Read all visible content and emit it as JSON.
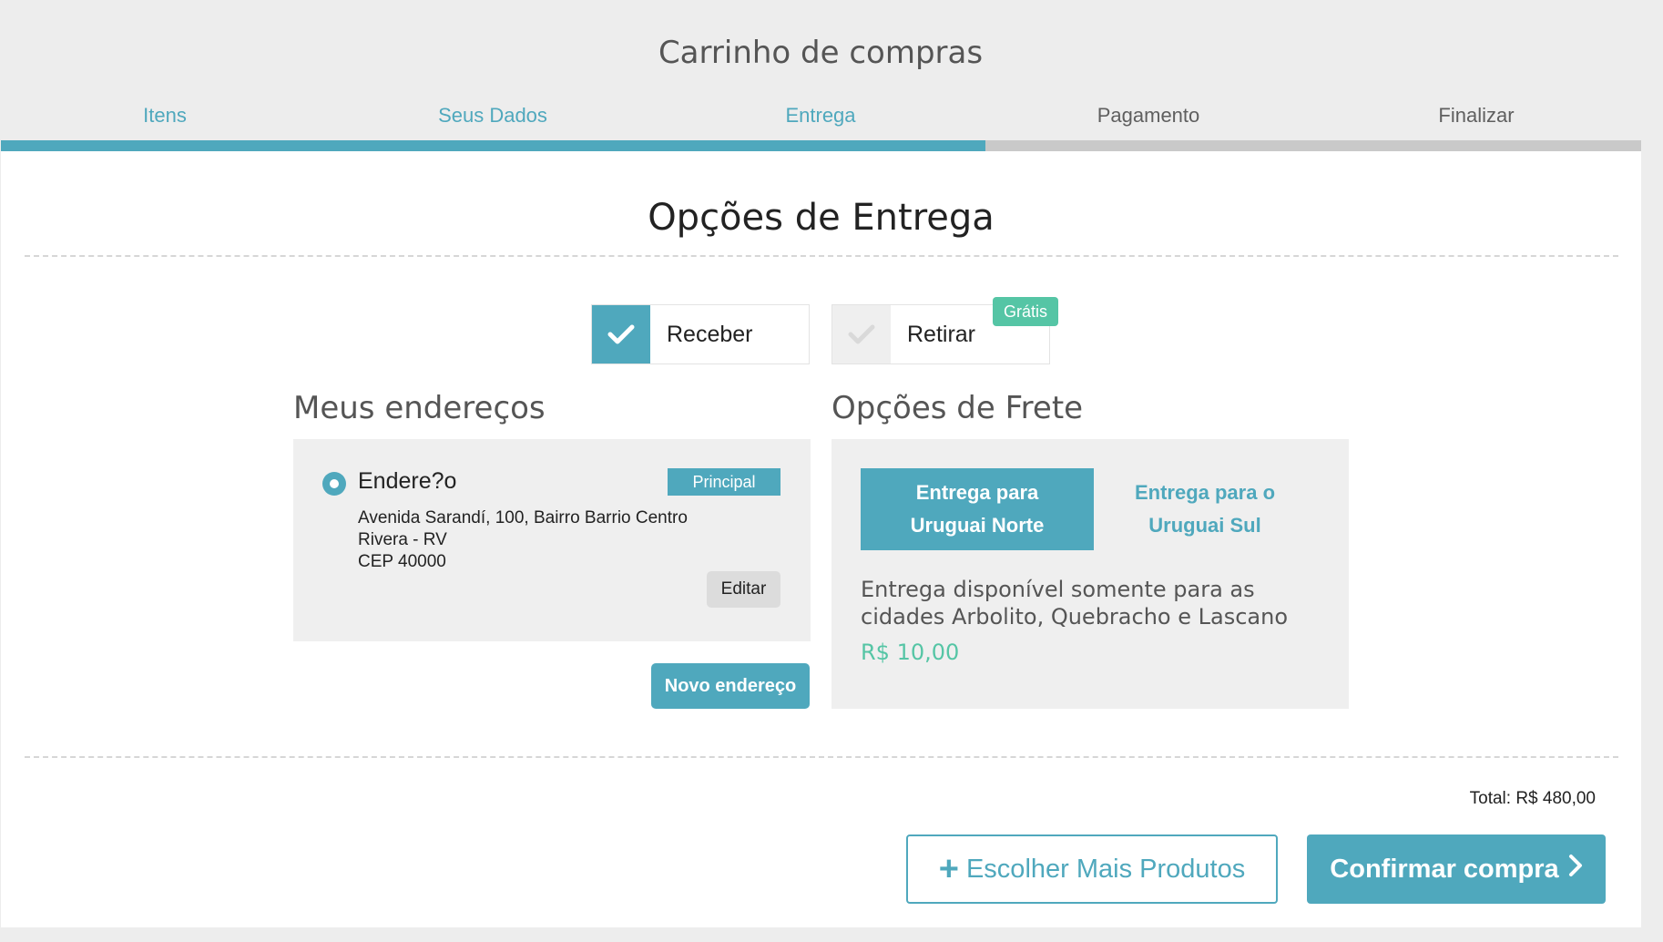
{
  "header": {
    "title": "Carrinho de compras"
  },
  "steps": [
    {
      "label": "Itens",
      "state": "done"
    },
    {
      "label": "Seus Dados",
      "state": "done"
    },
    {
      "label": "Entrega",
      "state": "done"
    },
    {
      "label": "Pagamento",
      "state": "todo"
    },
    {
      "label": "Finalizar",
      "state": "todo"
    }
  ],
  "progress": {
    "completed_fraction": 0.6
  },
  "delivery": {
    "title": "Opções de Entrega",
    "options": [
      {
        "label": "Receber",
        "selected": true
      },
      {
        "label": "Retirar",
        "selected": false,
        "badge": "Grátis"
      }
    ]
  },
  "addresses": {
    "title": "Meus endereços",
    "items": [
      {
        "name": "Endere?o",
        "badge": "Principal",
        "line1": "Avenida Sarandí, 100, Bairro Barrio Centro",
        "line2": "Rivera - RV",
        "line3": "CEP 40000",
        "edit_label": "Editar"
      }
    ],
    "new_label": "Novo endereço"
  },
  "freight": {
    "title": "Opções de Frete",
    "tabs": [
      {
        "line1": "Entrega para",
        "line2": "Uruguai Norte",
        "active": true
      },
      {
        "line1": "Entrega para o",
        "line2": "Uruguai Sul",
        "active": false
      }
    ],
    "description": "Entrega disponível somente para as cidades Arbolito, Quebracho e Lascano",
    "price": "R$ 10,00"
  },
  "footer": {
    "total": "Total: R$ 480,00",
    "more_label": "Escolher Mais Produtos",
    "confirm_label": "Confirmar compra"
  },
  "colors": {
    "accent": "#4fa8bd",
    "green": "#55c5a5",
    "panel_bg": "#efefef",
    "page_bg": "#ededed"
  },
  "icons": {
    "check": "check-icon",
    "plus": "plus-icon",
    "chevron": "chevron-right-icon"
  }
}
